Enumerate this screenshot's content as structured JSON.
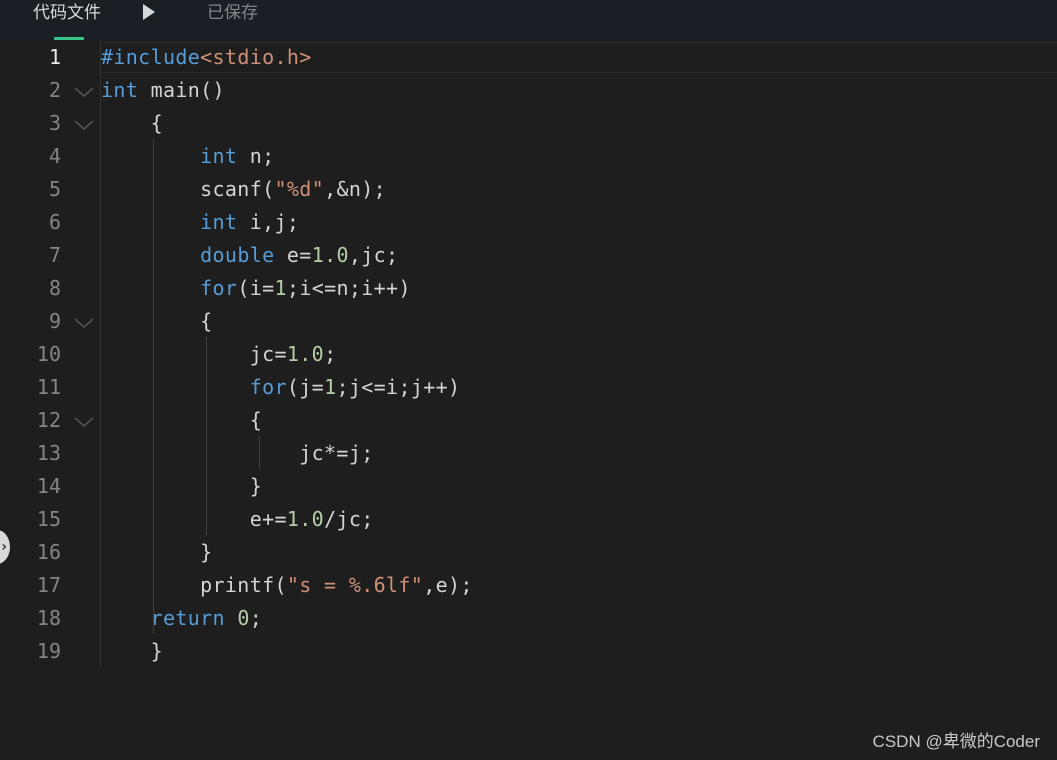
{
  "header": {
    "file_tab_label": "代码文件",
    "save_status": "已保存"
  },
  "colors": {
    "keyword": "#569cd6",
    "string": "#ce9178",
    "number": "#b5cea8",
    "plain": "#d4d4d4",
    "accent": "#3bc48a"
  },
  "editor": {
    "active_line": 1,
    "lines": [
      {
        "no": "1",
        "fold": false,
        "tokens": [
          {
            "t": "#include",
            "c": "kw"
          },
          {
            "t": "<stdio.h>",
            "c": "inc"
          }
        ]
      },
      {
        "no": "2",
        "fold": true,
        "tokens": [
          {
            "t": "int",
            "c": "kw"
          },
          {
            "t": " main()",
            "c": "plain"
          }
        ]
      },
      {
        "no": "3",
        "fold": true,
        "tokens": [
          {
            "t": "    {",
            "c": "plain"
          }
        ]
      },
      {
        "no": "4",
        "fold": false,
        "tokens": [
          {
            "t": "        ",
            "c": "plain"
          },
          {
            "t": "int",
            "c": "kw"
          },
          {
            "t": " n;",
            "c": "plain"
          }
        ]
      },
      {
        "no": "5",
        "fold": false,
        "tokens": [
          {
            "t": "        scanf(",
            "c": "plain"
          },
          {
            "t": "\"%d\"",
            "c": "str"
          },
          {
            "t": ",&n);",
            "c": "plain"
          }
        ]
      },
      {
        "no": "6",
        "fold": false,
        "tokens": [
          {
            "t": "        ",
            "c": "plain"
          },
          {
            "t": "int",
            "c": "kw"
          },
          {
            "t": " i,j;",
            "c": "plain"
          }
        ]
      },
      {
        "no": "7",
        "fold": false,
        "tokens": [
          {
            "t": "        ",
            "c": "plain"
          },
          {
            "t": "double",
            "c": "kw"
          },
          {
            "t": " e=",
            "c": "plain"
          },
          {
            "t": "1.0",
            "c": "num"
          },
          {
            "t": ",jc;",
            "c": "plain"
          }
        ]
      },
      {
        "no": "8",
        "fold": false,
        "tokens": [
          {
            "t": "        ",
            "c": "plain"
          },
          {
            "t": "for",
            "c": "kw"
          },
          {
            "t": "(i=",
            "c": "plain"
          },
          {
            "t": "1",
            "c": "num"
          },
          {
            "t": ";i<=n;i++)",
            "c": "plain"
          }
        ]
      },
      {
        "no": "9",
        "fold": true,
        "tokens": [
          {
            "t": "        {",
            "c": "plain"
          }
        ]
      },
      {
        "no": "10",
        "fold": false,
        "tokens": [
          {
            "t": "            jc=",
            "c": "plain"
          },
          {
            "t": "1.0",
            "c": "num"
          },
          {
            "t": ";",
            "c": "plain"
          }
        ]
      },
      {
        "no": "11",
        "fold": false,
        "tokens": [
          {
            "t": "            ",
            "c": "plain"
          },
          {
            "t": "for",
            "c": "kw"
          },
          {
            "t": "(j=",
            "c": "plain"
          },
          {
            "t": "1",
            "c": "num"
          },
          {
            "t": ";j<=i;j++)",
            "c": "plain"
          }
        ]
      },
      {
        "no": "12",
        "fold": true,
        "tokens": [
          {
            "t": "            {",
            "c": "plain"
          }
        ]
      },
      {
        "no": "13",
        "fold": false,
        "tokens": [
          {
            "t": "                jc*=j;",
            "c": "plain"
          }
        ]
      },
      {
        "no": "14",
        "fold": false,
        "tokens": [
          {
            "t": "            }",
            "c": "plain"
          }
        ]
      },
      {
        "no": "15",
        "fold": false,
        "tokens": [
          {
            "t": "            e+=",
            "c": "plain"
          },
          {
            "t": "1.0",
            "c": "num"
          },
          {
            "t": "/jc;",
            "c": "plain"
          }
        ]
      },
      {
        "no": "16",
        "fold": false,
        "tokens": [
          {
            "t": "        }",
            "c": "plain"
          }
        ]
      },
      {
        "no": "17",
        "fold": false,
        "tokens": [
          {
            "t": "        printf(",
            "c": "plain"
          },
          {
            "t": "\"s = %.6lf\"",
            "c": "str"
          },
          {
            "t": ",e);",
            "c": "plain"
          }
        ]
      },
      {
        "no": "18",
        "fold": false,
        "tokens": [
          {
            "t": "    ",
            "c": "plain"
          },
          {
            "t": "return",
            "c": "kw"
          },
          {
            "t": " ",
            "c": "plain"
          },
          {
            "t": "0",
            "c": "num"
          },
          {
            "t": ";",
            "c": "plain"
          }
        ]
      },
      {
        "no": "19",
        "fold": false,
        "tokens": [
          {
            "t": "    }",
            "c": "plain"
          }
        ]
      }
    ]
  },
  "watermark": "CSDN @卑微的Coder"
}
